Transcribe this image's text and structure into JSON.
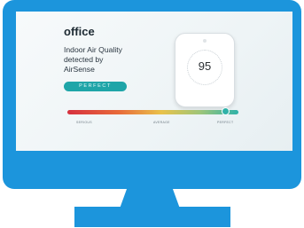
{
  "room": "office",
  "headline": {
    "line1": "Indoor Air Quality",
    "line2": "detected by",
    "line3": "AirSense"
  },
  "status": "PERFECT",
  "device": {
    "value": "95"
  },
  "gauge": {
    "score": 95,
    "scale_max": 100,
    "label_left": "SERIOUS",
    "label_mid": "AVERAGE",
    "label_right": "PERFECT"
  },
  "colors": {
    "frame": "#1c95dc",
    "status_pill": "#1fa5a8",
    "gauge_low": "#d6313f",
    "gauge_mid": "#e9c24a",
    "gauge_high": "#2fb2a8"
  }
}
